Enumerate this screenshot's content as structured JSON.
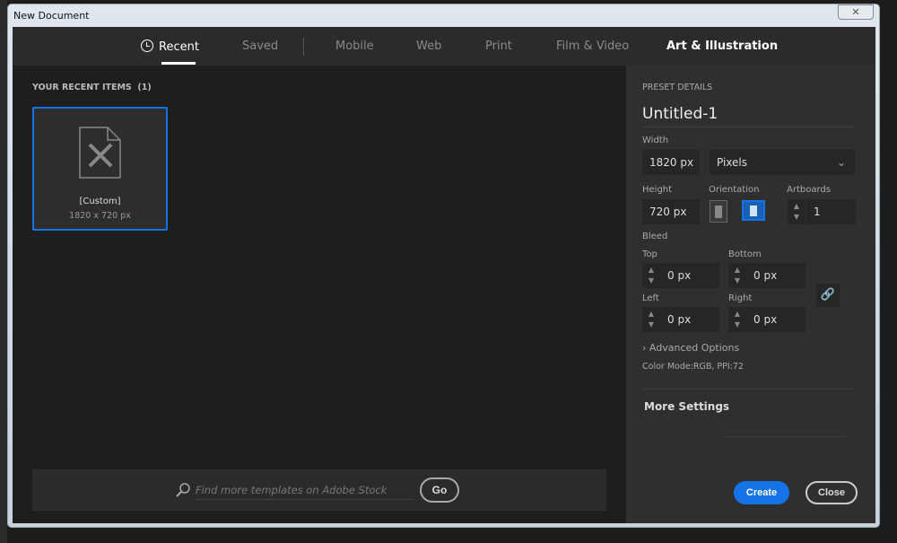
{
  "window": {
    "title": "New Document",
    "close_icon": "close-icon"
  },
  "tabs": [
    {
      "label": "Recent",
      "state": "active",
      "icon": "clock-icon"
    },
    {
      "label": "Saved"
    },
    {
      "label": "Mobile"
    },
    {
      "label": "Web"
    },
    {
      "label": "Print"
    },
    {
      "label": "Film & Video"
    },
    {
      "label": "Art & Illustration"
    }
  ],
  "recent": {
    "title": "YOUR RECENT ITEMS",
    "count": "(1)",
    "items": [
      {
        "name": "[Custom]",
        "size": "1820 x 720 px",
        "icon": "document-pencil-ruler-icon"
      }
    ]
  },
  "search": {
    "placeholder": "Find more templates on Adobe Stock",
    "go": "Go"
  },
  "preset": {
    "section": "PRESET DETAILS",
    "name": "Untitled-1",
    "width_label": "Width",
    "width": "1820 px",
    "unit": "Pixels",
    "height_label": "Height",
    "height": "720 px",
    "orientation_label": "Orientation",
    "orientation": "landscape",
    "artboards_label": "Artboards",
    "artboards": "1",
    "bleed_label": "Bleed",
    "top_label": "Top",
    "top": "0 px",
    "bottom_label": "Bottom",
    "bottom": "0 px",
    "left_label": "Left",
    "left": "0 px",
    "right_label": "Right",
    "right": "0 px",
    "advanced": "Advanced Options",
    "color_mode": "Color Mode:RGB, PPI:72",
    "more_settings": "More Settings",
    "create": "Create",
    "close": "Close"
  },
  "colors": {
    "accent": "#1473e6"
  }
}
